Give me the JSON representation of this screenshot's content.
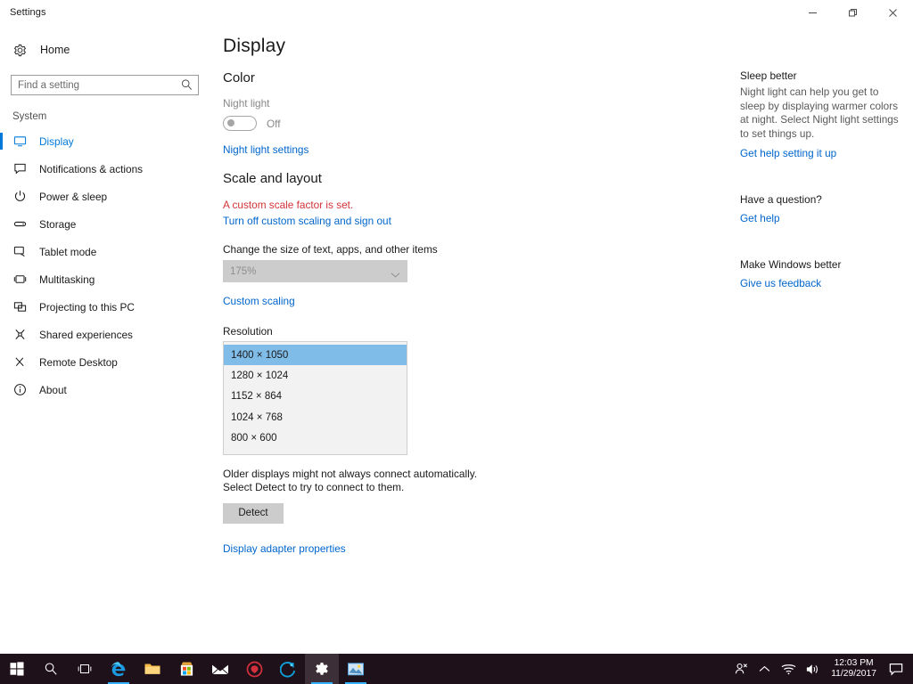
{
  "window": {
    "title": "Settings",
    "controls": [
      {
        "name": "minimize-button",
        "glyph": "minimize"
      },
      {
        "name": "restore-button",
        "glyph": "restore"
      },
      {
        "name": "close-button",
        "glyph": "close"
      }
    ]
  },
  "sidebar": {
    "home_label": "Home",
    "home_icon": "gear-icon",
    "search": {
      "placeholder": "Find a setting",
      "value": "",
      "icon": "search-icon"
    },
    "group_header": "System",
    "items": [
      {
        "label": "Display",
        "icon": "monitor-icon",
        "selected": true
      },
      {
        "label": "Notifications & actions",
        "icon": "notification-icon",
        "selected": false
      },
      {
        "label": "Power & sleep",
        "icon": "power-icon",
        "selected": false
      },
      {
        "label": "Storage",
        "icon": "storage-icon",
        "selected": false
      },
      {
        "label": "Tablet mode",
        "icon": "tablet-icon",
        "selected": false
      },
      {
        "label": "Multitasking",
        "icon": "multitasking-icon",
        "selected": false
      },
      {
        "label": "Projecting to this PC",
        "icon": "projecting-icon",
        "selected": false
      },
      {
        "label": "Shared experiences",
        "icon": "shared-experiences-icon",
        "selected": false
      },
      {
        "label": "Remote Desktop",
        "icon": "remote-desktop-icon",
        "selected": false
      },
      {
        "label": "About",
        "icon": "info-icon",
        "selected": false
      }
    ]
  },
  "main": {
    "page_title": "Display",
    "color": {
      "section_title": "Color",
      "night_light_label": "Night light",
      "night_light_state": "Off",
      "night_light_settings_link": "Night light settings"
    },
    "scale": {
      "section_title": "Scale and layout",
      "warning": "A custom scale factor is set.",
      "turn_off_link": "Turn off custom scaling and sign out",
      "size_label": "Change the size of text, apps, and other items",
      "scale_value": "175%",
      "custom_scaling_link": "Custom scaling"
    },
    "resolution": {
      "label": "Resolution",
      "options": [
        "1400 × 1050",
        "1280 × 1024",
        "1152 × 864",
        "1024 × 768",
        "800 × 600"
      ],
      "selected_index": 0
    },
    "detect": {
      "help_text": "Older displays might not always connect automatically. Select Detect to try to connect to them.",
      "button_label": "Detect"
    },
    "adapter_link": "Display adapter properties"
  },
  "rail": {
    "sections": [
      {
        "heading": "Sleep better",
        "body": "Night light can help you get to sleep by displaying warmer colors at night. Select Night light settings to set things up.",
        "link": "Get help setting it up"
      },
      {
        "heading": "Have a question?",
        "body": "",
        "link": "Get help"
      },
      {
        "heading": "Make Windows better",
        "body": "",
        "link": "Give us feedback"
      }
    ]
  },
  "taskbar": {
    "items": [
      {
        "name": "start-button",
        "icon": "windows-logo-icon",
        "active": false,
        "running": false
      },
      {
        "name": "search-button",
        "icon": "search-icon",
        "active": false,
        "running": false
      },
      {
        "name": "task-view-button",
        "icon": "task-view-icon",
        "active": false,
        "running": false
      },
      {
        "name": "edge-button",
        "icon": "edge-icon",
        "active": false,
        "running": true
      },
      {
        "name": "file-explorer-button",
        "icon": "folder-icon",
        "active": false,
        "running": false
      },
      {
        "name": "store-button",
        "icon": "store-icon",
        "active": false,
        "running": false
      },
      {
        "name": "mail-button",
        "icon": "mail-icon",
        "active": false,
        "running": false
      },
      {
        "name": "app-red-button",
        "icon": "red-circle-app-icon",
        "active": false,
        "running": false
      },
      {
        "name": "app-blue-button",
        "icon": "blue-circle-app-icon",
        "active": false,
        "running": false
      },
      {
        "name": "settings-button",
        "icon": "gear-icon",
        "active": true,
        "running": true
      },
      {
        "name": "photo-app-button",
        "icon": "picture-icon",
        "active": false,
        "running": true
      }
    ],
    "tray": [
      {
        "name": "people-icon",
        "icon": "people"
      },
      {
        "name": "show-hidden-icons-button",
        "icon": "chevron-up"
      },
      {
        "name": "network-icon",
        "icon": "wifi"
      },
      {
        "name": "volume-icon",
        "icon": "speaker"
      }
    ],
    "clock": {
      "time": "12:03 PM",
      "date": "11/29/2017"
    },
    "action_center_icon": "action-center-icon"
  },
  "colors": {
    "accent": "#0078d7",
    "link": "#0066cc",
    "warning": "#d13438",
    "selection": "#80bce8",
    "taskbar": "#1f1119"
  }
}
